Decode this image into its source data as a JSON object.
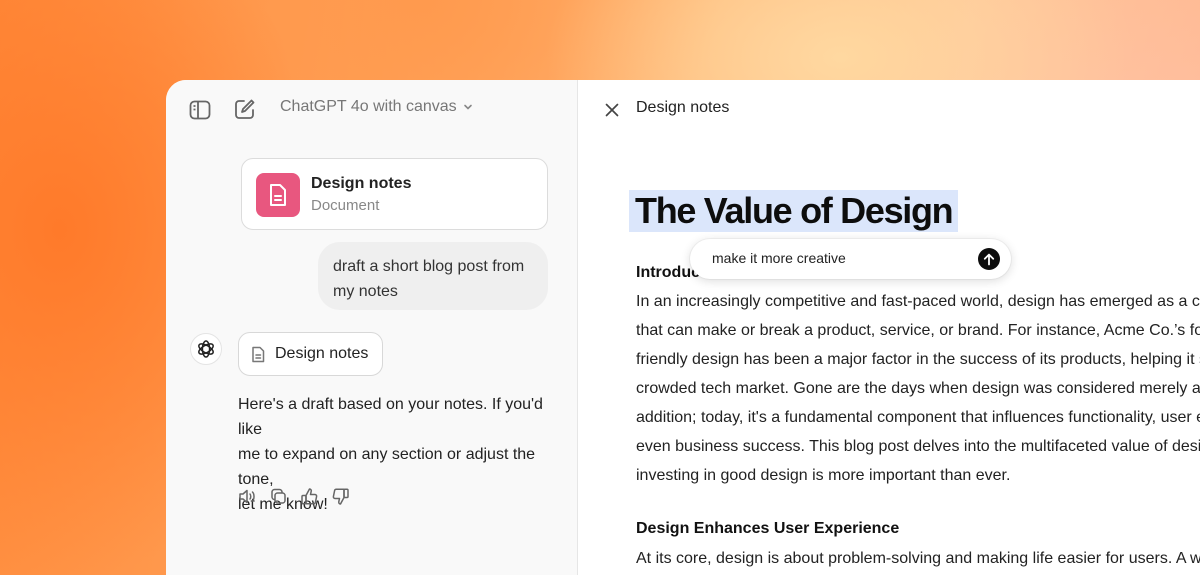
{
  "chat": {
    "model_label": "ChatGPT 4o with canvas",
    "doc_card": {
      "title": "Design notes",
      "type": "Document"
    },
    "user_message_lines": [
      "draft a short blog post from",
      "my notes"
    ],
    "doc_chip_label": "Design notes",
    "assistant_lines": [
      "Here's a draft based on your notes. If you'd like",
      "me to expand on any section or adjust the tone,",
      "let me know!"
    ]
  },
  "canvas": {
    "title": "Design notes",
    "heading": "The Value of Design",
    "intro_label": "Introduction",
    "intro_lines": [
      "In an increasingly competitive and fast-paced world, design has emerged as a critical",
      "that can make or break a product, service, or brand. For instance, Acme Co.’s focus on",
      "friendly design has been a major factor in the success of its products, helping it stand",
      "crowded tech market. Gone are the days when design was considered merely an aesthetic",
      "addition; today, it's a fundamental component that influences functionality, user experience,",
      "even business success. This blog post delves into the multifaceted value of design and",
      "investing in good design is more important than ever."
    ],
    "section_heading": "Design Enhances User Experience",
    "section_line": "At its core, design is about problem-solving and making life easier for users. A well-designed",
    "edit_prompt_value": "make it more creative"
  },
  "colors": {
    "doc_thumb": "#e8577f",
    "selection_highlight": "#dbe6fb",
    "send_button": "#0d0d0d"
  }
}
